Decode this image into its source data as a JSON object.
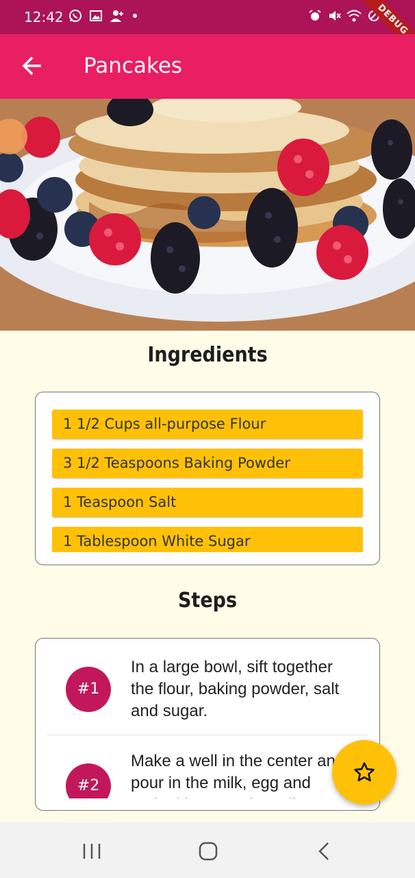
{
  "status_bar": {
    "time": "12:42",
    "left_icons": [
      "whatsapp-icon",
      "gallery-icon",
      "person-add-icon",
      "dot-icon"
    ],
    "right_icons": [
      "alarm-icon",
      "mute-icon",
      "wifi-icon",
      "no-signal-icon"
    ],
    "debug_label": "DEBUG"
  },
  "app_bar": {
    "title": "Pancakes",
    "back_icon": "arrow-back-icon",
    "color": "#e91e63"
  },
  "hero_image": {
    "subject": "pancakes-with-berries-photo"
  },
  "ingredients": {
    "title": "Ingredients",
    "items": [
      "1 1/2 Cups all-purpose Flour",
      "3 1/2 Teaspoons Baking Powder",
      "1 Teaspoon Salt",
      "1 Tablespoon White Sugar"
    ],
    "item_color": "#ffc107"
  },
  "steps": {
    "title": "Steps",
    "items": [
      {
        "badge": "#1",
        "text": "In a large bowl, sift together the flour, baking powder, salt and sugar."
      },
      {
        "badge": "#2",
        "text": "Make a well in the center and pour in the milk, egg and melted butter; mix until smooth."
      }
    ],
    "badge_color": "#c2185b"
  },
  "fab": {
    "icon": "star-outline-icon",
    "color": "#ffc107"
  },
  "nav_bar": {
    "icons": [
      "recent-apps-icon",
      "home-icon",
      "back-icon"
    ]
  }
}
